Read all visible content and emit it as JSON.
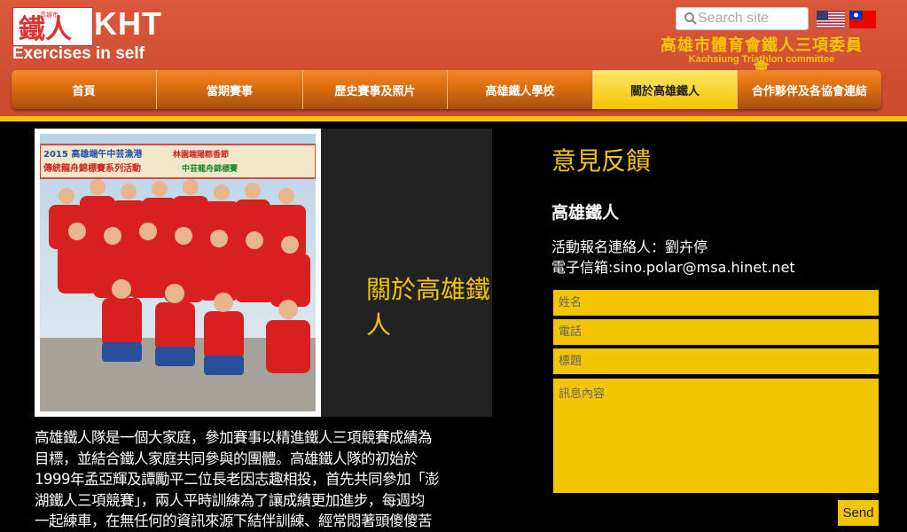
{
  "header": {
    "logo_badge_text": "鐵人",
    "logo_small_text": "高雄市",
    "logo_text": "KHT",
    "tagline": "Exercises in self",
    "search_placeholder": "Search site",
    "org_name": "高雄市體育會鐵人三項委員會",
    "org_subtitle": "Kaohsiung Triathlon committee",
    "flags": [
      "us-flag",
      "taiwan-flag"
    ]
  },
  "nav": {
    "items": [
      {
        "label": "首頁"
      },
      {
        "label": "當期賽事"
      },
      {
        "label": "歷史賽事及照片"
      },
      {
        "label": "高雄鐵人學校"
      },
      {
        "label": "關於高雄鐵人",
        "active": true
      },
      {
        "label": "合作夥伴及各協會連結"
      }
    ]
  },
  "about": {
    "title": "關於高雄鐵人",
    "banner_line1": "2015 高雄端午中芸漁港",
    "banner_line2": "傳統龍舟錦標賽系列活動",
    "banner_line3": "林園端陽粽香節",
    "banner_line4": "中芸龍舟錦標賽",
    "paragraph_lines": [
      "高雄鐵人隊是一個大家庭，參加賽事以精進鐵人三項競賽成績為",
      "目標，並結合鐵人家庭共同參與的團體。高雄鐵人隊的初始於",
      "1999年孟亞輝及譚勵平二位長老因志趣相投，首先共同參加「澎",
      "湖鐵人三項競賽」，兩人平時訓練為了讓成績更加進步，每週均",
      "一起練車，在無任何的資訊來源下結伴訓練、經常悶著頭傻傻苦"
    ]
  },
  "feedback": {
    "title": "意見反饋",
    "org": "高雄鐵人",
    "contact_person": "活動報名連絡人：劉卉停",
    "email_line": "電子信箱:sino.polar@msa.hinet.net",
    "name_placeholder": "姓名",
    "phone_placeholder": "電話",
    "subject_placeholder": "標題",
    "message_placeholder": "訊息內容",
    "send_label": "Send"
  },
  "colors": {
    "header_bg": "#d9573a",
    "accent_yellow": "#f2c500",
    "nav_orange": "#e0700f",
    "page_bg": "#000000"
  }
}
